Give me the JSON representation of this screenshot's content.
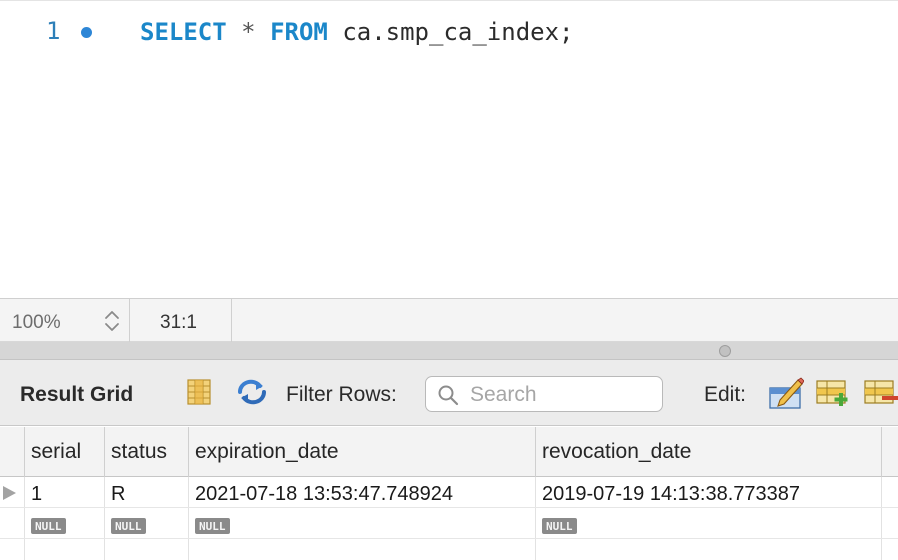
{
  "editor": {
    "line_number": "1",
    "code": {
      "kw_select": "SELECT",
      "star": "*",
      "kw_from": "FROM",
      "table": "ca.smp_ca_index;"
    }
  },
  "status": {
    "zoom": "100%",
    "cursor": "31:1"
  },
  "toolbar": {
    "result_grid_label": "Result Grid",
    "filter_label": "Filter Rows:",
    "search_placeholder": "Search",
    "edit_label": "Edit:",
    "icons": [
      "grid-view-icon",
      "refresh-icon",
      "search-icon",
      "edit-row-icon",
      "insert-row-icon",
      "delete-row-icon"
    ]
  },
  "grid": {
    "columns": [
      "serial",
      "status",
      "expiration_date",
      "revocation_date"
    ],
    "rows": [
      [
        "1",
        "R",
        "2021-07-18 13:53:47.748924",
        "2019-07-19 14:13:38.773387"
      ]
    ],
    "new_row": [
      "NULL",
      "NULL",
      "NULL",
      "NULL"
    ]
  },
  "colors": {
    "keyword": "#1b87c9",
    "line_number": "#2d7fb8",
    "breakpoint_dot": "#2d86d6",
    "toolbar_bg": "#ececec",
    "null_badge": "#8a8a8a"
  }
}
